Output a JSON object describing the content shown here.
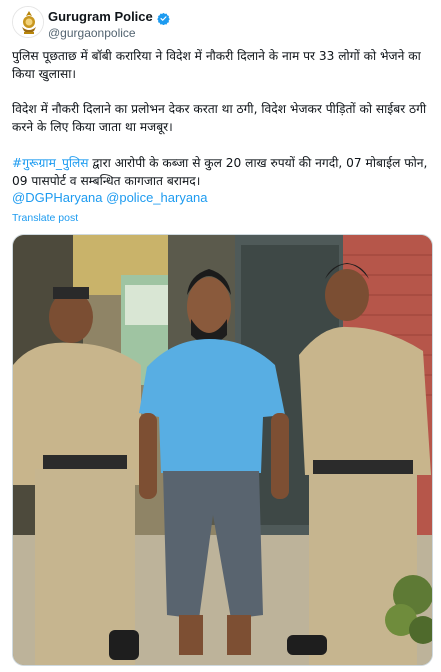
{
  "account": {
    "display_name": "Gurugram Police",
    "handle": "@gurgaonpolice",
    "avatar_icon": "police-emblem-icon",
    "verified_icon": "verified-badge-icon",
    "accent": "#1d9bf0"
  },
  "post": {
    "paragraph1": "पुलिस पूछताछ में बॉबी करारिया ने विदेश में नौकरी दिलाने के नाम पर 33 लोगों को भेजने का किया खुलासा।",
    "paragraph2": "विदेश में नौकरी दिलाने का प्रलोभन देकर करता था ठगी, विदेश भेजकर पीड़ितों को साईबर ठगी करने के लिए किया जाता था मजबूर।",
    "hashtag": "#गुरूग्राम_पुलिस",
    "paragraph3_rest": " द्वारा आरोपी के कब्जा से कुल 20 लाख रुपयों की नगदी, 07 मोबाईल फोन, 09 पासपोर्ट व सम्बन्धित कागजात बरामद।",
    "mention1": "@DGPHaryana",
    "mention2": "@police_haryana",
    "translate_label": "Translate post"
  }
}
